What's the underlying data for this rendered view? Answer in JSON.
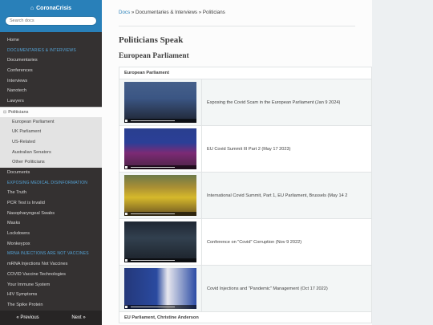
{
  "sidebar": {
    "brand": "CoronaCrisis",
    "brand_icon": "home-icon",
    "search_placeholder": "Search docs",
    "items": [
      {
        "label": "Home",
        "type": "item"
      },
      {
        "label": "DOCUMENTARIES & INTERVIEWS",
        "type": "caption"
      },
      {
        "label": "Documentaries",
        "type": "item"
      },
      {
        "label": "Conferences",
        "type": "item"
      },
      {
        "label": "Interviews",
        "type": "item"
      },
      {
        "label": "Nanotech",
        "type": "item"
      },
      {
        "label": "Lawyers",
        "type": "item"
      },
      {
        "label": "Politicians",
        "type": "current"
      },
      {
        "label": "European Parliament",
        "type": "sub"
      },
      {
        "label": "UK Parliament",
        "type": "sub"
      },
      {
        "label": "US-Related",
        "type": "sub"
      },
      {
        "label": "Australian Senators",
        "type": "sub"
      },
      {
        "label": "Other Politicians",
        "type": "sub"
      },
      {
        "label": "Documents",
        "type": "item"
      },
      {
        "label": "EXPOSING MEDICAL DISINFORMATION",
        "type": "caption"
      },
      {
        "label": "The Truth",
        "type": "item"
      },
      {
        "label": "PCR Test is Invalid",
        "type": "item"
      },
      {
        "label": "Nasopharyngeal Swabs",
        "type": "item"
      },
      {
        "label": "Masks",
        "type": "item"
      },
      {
        "label": "Lockdowns",
        "type": "item"
      },
      {
        "label": "Monkeypox",
        "type": "item"
      },
      {
        "label": "MRNA INJECTIONS ARE NOT VACCINES",
        "type": "caption"
      },
      {
        "label": "mRNA Injections Not Vaccines",
        "type": "item"
      },
      {
        "label": "COVID Vaccine Technologies",
        "type": "item"
      },
      {
        "label": "Your Immune System",
        "type": "item"
      },
      {
        "label": "HIV Symptoms",
        "type": "item"
      },
      {
        "label": "The Spike Protein",
        "type": "item"
      }
    ],
    "prev_label": "« Previous",
    "next_label": "Next »"
  },
  "breadcrumb": {
    "docs": "Docs",
    "sep1": " » ",
    "level1": "Documentaries & Interviews",
    "sep2": " » ",
    "level2": "Politicians"
  },
  "page_title": "Politicians Speak",
  "section_title": "European Parliament",
  "table": {
    "header": "European Parliament",
    "rows": [
      {
        "title": "Exposing the Covid Scam in the European Parliament (Jan 9 2024)"
      },
      {
        "title": "EU Covid Summit III Part 2 (May 17 2023)"
      },
      {
        "title": "International Covid Summit, Part 1, EU Parliament, Brussels (May 14 2"
      },
      {
        "title": "Conference on \"Covid\" Corruption (Nov 9 2022)"
      },
      {
        "title": "Covid Injections and \"Pandemic\" Management (Oct 17 2022)"
      }
    ],
    "next_header": "EU Parliament, Christine Anderson"
  }
}
